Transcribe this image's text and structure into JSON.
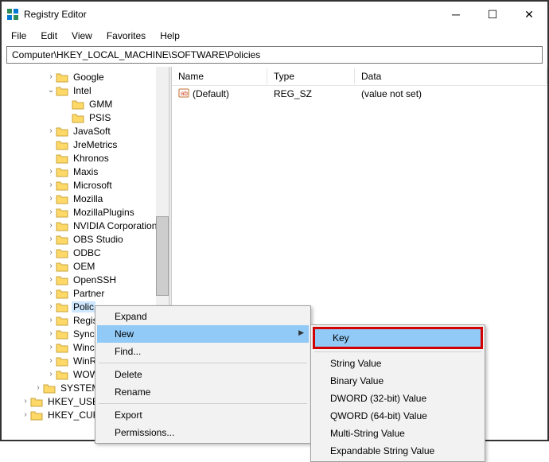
{
  "window": {
    "title": "Registry Editor"
  },
  "menu": {
    "file": "File",
    "edit": "Edit",
    "view": "View",
    "favorites": "Favorites",
    "help": "Help"
  },
  "address": {
    "path": "Computer\\HKEY_LOCAL_MACHINE\\SOFTWARE\\Policies"
  },
  "columns": {
    "name": "Name",
    "type": "Type",
    "data": "Data"
  },
  "values": [
    {
      "name": "(Default)",
      "type": "REG_SZ",
      "data": "(value not set)"
    }
  ],
  "tree": {
    "google": "Google",
    "intel": "Intel",
    "gmm": "GMM",
    "psis": "PSIS",
    "javasoft": "JavaSoft",
    "jremetrics": "JreMetrics",
    "khronos": "Khronos",
    "maxis": "Maxis",
    "microsoft": "Microsoft",
    "mozilla": "Mozilla",
    "mozillaplugins": "MozillaPlugins",
    "nvidia": "NVIDIA Corporation",
    "obs": "OBS Studio",
    "odbc": "ODBC",
    "oem": "OEM",
    "openssh": "OpenSSH",
    "partner": "Partner",
    "policies": "Polic",
    "regis": "Regis",
    "sync": "Sync",
    "winc": "Winc",
    "winr": "WinR",
    "wow": "WOW",
    "system": "SYSTEM",
    "hkey_user": "HKEY_USER",
    "hkey_cur": "HKEY_CUR"
  },
  "ctx": {
    "expand": "Expand",
    "new": "New",
    "find": "Find...",
    "delete": "Delete",
    "rename": "Rename",
    "export": "Export",
    "permissions": "Permissions..."
  },
  "submenu": {
    "key": "Key",
    "string": "String Value",
    "binary": "Binary Value",
    "dword": "DWORD (32-bit) Value",
    "qword": "QWORD (64-bit) Value",
    "multistring": "Multi-String Value",
    "expandable": "Expandable String Value"
  }
}
